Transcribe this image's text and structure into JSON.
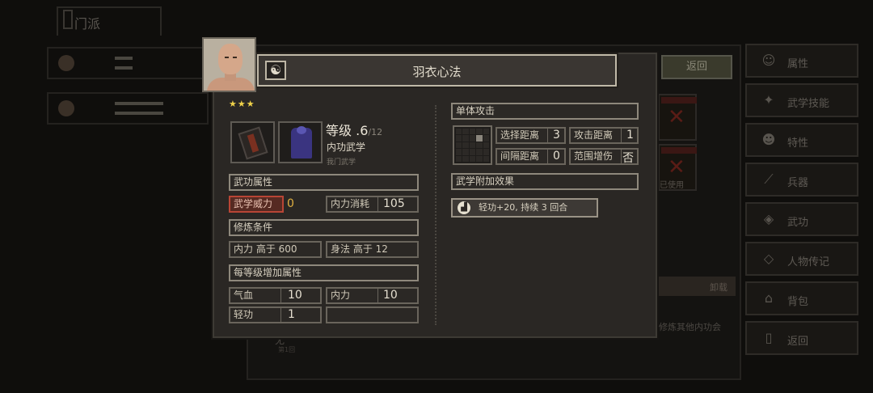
{
  "background": {
    "tab_label": "门派",
    "return_button": "返回",
    "slot_status": "已使用",
    "unequip_button": "卸载",
    "note_text": "修炼其他内功会",
    "note_left": "无",
    "note_left_sub": "第1回",
    "side_menu": [
      {
        "icon": "person-icon",
        "label": "属性"
      },
      {
        "icon": "martial-icon",
        "label": "武学技能"
      },
      {
        "icon": "stats-icon",
        "label": "特性"
      },
      {
        "icon": "sword-icon",
        "label": "兵器"
      },
      {
        "icon": "scroll-icon",
        "label": "武功"
      },
      {
        "icon": "diamond-icon",
        "label": "人物传记"
      },
      {
        "icon": "bag-icon",
        "label": "背包"
      },
      {
        "icon": "door-icon",
        "label": "返回"
      }
    ]
  },
  "skill": {
    "name": "羽衣心法",
    "stars": "★★★",
    "level_label": "等级",
    "level_value": ".6",
    "level_max": "/12",
    "category": "内功武学",
    "sect": "我门武学",
    "attrs_header": "武功属性",
    "power_label": "武学威力",
    "power_value": "0",
    "cost_label": "内力消耗",
    "cost_value": "105",
    "req_header": "修炼条件",
    "req_1": "内力 高于 600",
    "req_2": "身法 高于 12",
    "growth_header": "每等级增加属性",
    "growth": [
      {
        "label": "气血",
        "value": "10"
      },
      {
        "label": "内力",
        "value": "10"
      },
      {
        "label": "轻功",
        "value": "1"
      },
      {
        "label": "",
        "value": ""
      }
    ],
    "attack_type": "单体攻击",
    "select_range_label": "选择距离",
    "select_range_value": "3",
    "attack_range_label": "攻击距离",
    "attack_range_value": "1",
    "interval_label": "间隔距离",
    "interval_value": "0",
    "aoe_label": "范围增伤",
    "aoe_value": "否",
    "extra_header": "武学附加效果",
    "effect_text": "轻功+20, 持续 3 回合"
  },
  "colors": {
    "accent_red": "#b84535",
    "gold": "#e0b040",
    "star": "#f0d24a"
  }
}
